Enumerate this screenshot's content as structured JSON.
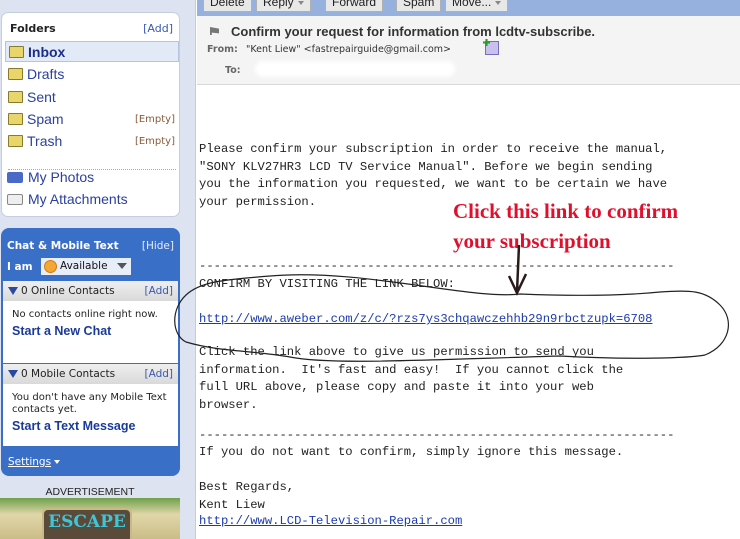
{
  "toolbar": {
    "buttons": [
      {
        "label": "Delete"
      },
      {
        "label": "Reply"
      },
      {
        "label": "Forward"
      },
      {
        "label": "Spam"
      },
      {
        "label": "Move..."
      }
    ]
  },
  "sidebar": {
    "folders_title": "Folders",
    "folders_add": "[Add]",
    "folders": [
      {
        "label": "Inbox",
        "icon": "inbox-folder-icon",
        "active": true
      },
      {
        "label": "Drafts",
        "icon": "drafts-folder-icon"
      },
      {
        "label": "Sent",
        "icon": "sent-folder-icon"
      },
      {
        "label": "Spam",
        "icon": "spam-folder-icon",
        "action": "[Empty]"
      },
      {
        "label": "Trash",
        "icon": "trash-folder-icon",
        "action": "[Empty]"
      }
    ],
    "extras": [
      {
        "label": "My Photos",
        "icon": "photos-icon"
      },
      {
        "label": "My Attachments",
        "icon": "paperclip-icon"
      }
    ],
    "chat": {
      "title": "Chat & Mobile Text",
      "hide": "[Hide]",
      "iam": "I am",
      "status": "Available",
      "online_header": "0 Online Contacts",
      "online_add": "[Add]",
      "online_empty": "No contacts online right now.",
      "online_action": "Start a New Chat",
      "mobile_header": "0 Mobile Contacts",
      "mobile_add": "[Add]",
      "mobile_empty": "You don't have any Mobile Text contacts yet.",
      "mobile_action": "Start a Text Message",
      "settings": "Settings"
    },
    "ad_label": "ADVERTISEMENT",
    "ad_text": "ESCAPE"
  },
  "message": {
    "subject": "Confirm your request for information from lcdtv-subscribe.",
    "from_label": "From:",
    "from_value": "\"Kent Liew\" <fastrepairguide@gmail.com>",
    "to_label": "To:",
    "body": {
      "para1": "Please confirm your subscription in order to receive the manual,\n\"SONY KLV27HR3 LCD TV Service Manual\". Before we begin sending\nyou the information you requested, we want to be certain we have\nyour permission.",
      "divider1": "-----------------------------------------------------------------",
      "confirm_heading": "CONFIRM BY VISITING THE LINK BELOW:",
      "confirm_link": "http://www.aweber.com/z/c/?rzs7ys3chqawczehhb29n9rbctzupk=6708",
      "para2": "Click the link above to give us permission to send you\ninformation.  It's fast and easy!  If you cannot click the\nfull URL above, please copy and paste it into your web\nbrowser.",
      "divider2": "-----------------------------------------------------------------",
      "ignore": "If you do not want to confirm, simply ignore this message.",
      "signoff": "Best Regards,\nKent Liew",
      "site_link": "http://www.LCD-Television-Repair.com"
    }
  },
  "annotation": {
    "text_line1": "Click this link to confirm",
    "text_line2": "your subscription",
    "color": "#e0102c"
  }
}
